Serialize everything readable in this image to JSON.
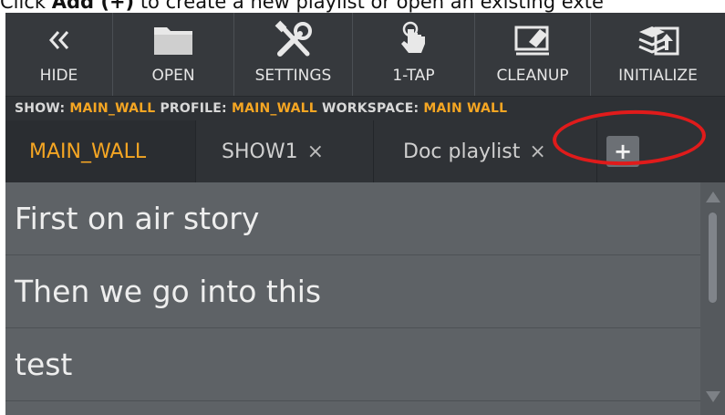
{
  "caption": {
    "prefix": "Click ",
    "strong": "Add (+)",
    "suffix": " to create a new playlist or open an existing exte"
  },
  "toolbar": {
    "items": [
      {
        "label": "HIDE",
        "icon": "double-chevron-left-icon"
      },
      {
        "label": "OPEN",
        "icon": "folder-icon"
      },
      {
        "label": "SETTINGS",
        "icon": "tools-icon"
      },
      {
        "label": "1-TAP",
        "icon": "tap-hand-icon"
      },
      {
        "label": "CLEANUP",
        "icon": "eraser-icon"
      },
      {
        "label": "INITIALIZE",
        "icon": "initialize-icon"
      }
    ]
  },
  "status": {
    "show_label": "SHOW:",
    "show_value": "MAIN_WALL",
    "profile_label": "PROFILE:",
    "profile_value": "MAIN_WALL",
    "workspace_label": "WORKSPACE:",
    "workspace_value": "MAIN WALL"
  },
  "tabs": [
    {
      "label": "MAIN_WALL",
      "active": true,
      "closable": false
    },
    {
      "label": "SHOW1",
      "active": false,
      "closable": true,
      "close_glyph": "×"
    },
    {
      "label": "Doc playlist",
      "active": false,
      "closable": true,
      "close_glyph": "×"
    }
  ],
  "add_tab": {
    "glyph": "+"
  },
  "playlist": {
    "items": [
      {
        "label": "First on air story"
      },
      {
        "label": "Then we go into this"
      },
      {
        "label": "test"
      }
    ]
  },
  "colors": {
    "accent": "#f5a623",
    "highlight": "#e01b1b",
    "toolbar_bg": "#36393d",
    "list_bg": "#5e6266"
  }
}
